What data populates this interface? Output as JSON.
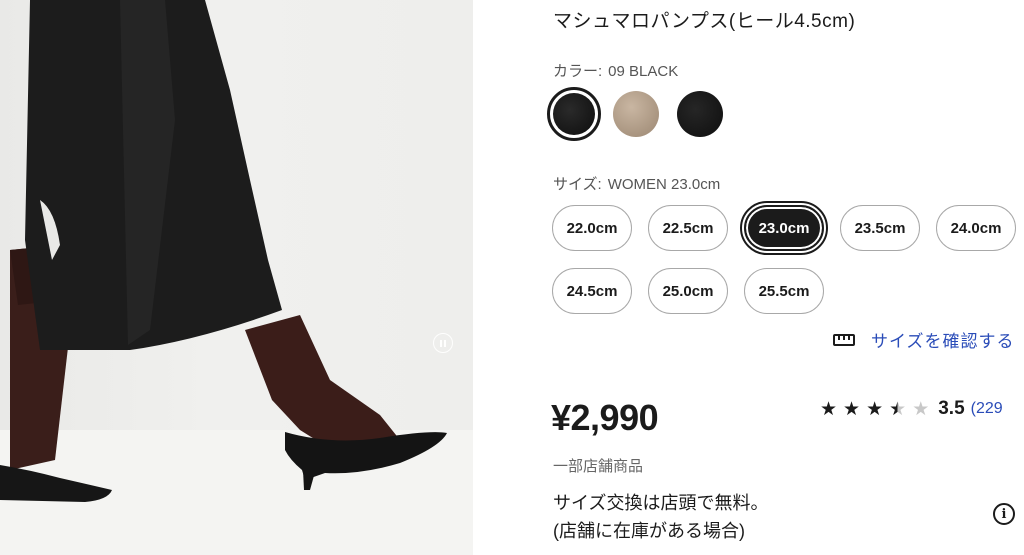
{
  "product": {
    "title": "マシュマロパンプス(ヒール4.5cm)"
  },
  "color": {
    "label": "カラー:",
    "selected_value": "09 BLACK",
    "swatches": [
      {
        "name": "black",
        "hex": "#111111",
        "selected": true
      },
      {
        "name": "beige",
        "hex": "#b5a18c",
        "selected": false
      },
      {
        "name": "black-smooth",
        "hex": "#151515",
        "selected": false
      }
    ]
  },
  "size": {
    "label": "サイズ:",
    "selected_value": "WOMEN 23.0cm",
    "options": [
      "22.0cm",
      "22.5cm",
      "23.0cm",
      "23.5cm",
      "24.0cm",
      "24.5cm",
      "25.0cm",
      "25.5cm"
    ],
    "selected_index": 2,
    "check_link": "サイズを確認する",
    "check_icon": "ruler-icon"
  },
  "price": {
    "amount": "¥2,990",
    "stock_note": "一部店舗商品"
  },
  "rating": {
    "score": 3.5,
    "score_text": "3.5",
    "count_text": "(229",
    "stars_max": 5
  },
  "exchange": {
    "line1": "サイズ交換は店頭で無料。",
    "line2": "(店舗に在庫がある場合)",
    "info_icon": "info-icon"
  },
  "media": {
    "pause_icon": "pause-icon"
  }
}
